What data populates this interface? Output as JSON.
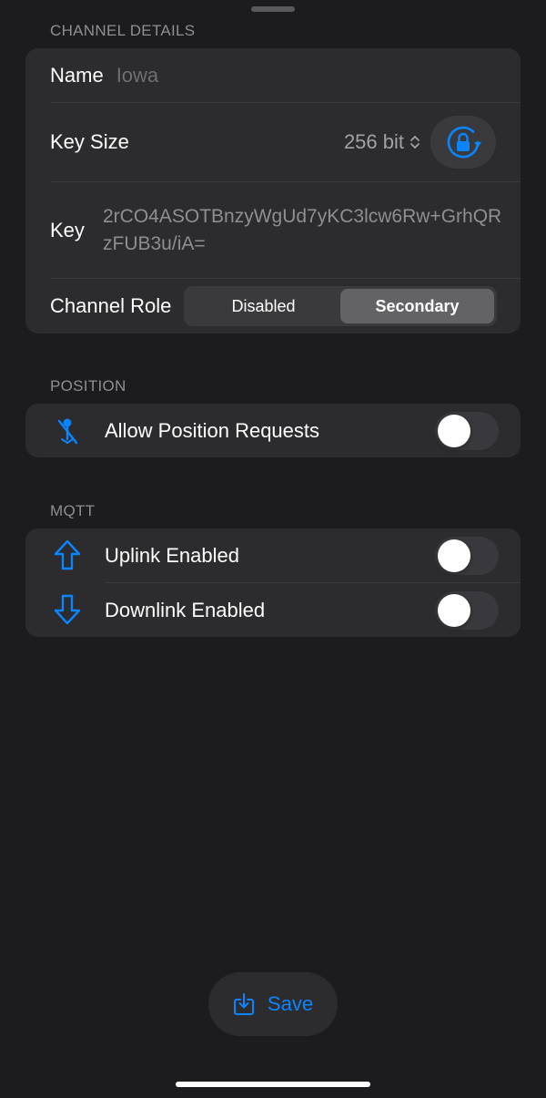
{
  "colors": {
    "background": "#1c1c1e",
    "card": "#2c2c2e",
    "accent": "#0a84ff",
    "secondary_text": "#8e8e93"
  },
  "channel_details": {
    "header": "CHANNEL DETAILS",
    "name_label": "Name",
    "name_value": "Iowa",
    "key_size_label": "Key Size",
    "key_size_value": "256 bit",
    "key_label": "Key",
    "key_value": "2rCO4ASOTBnzyWgUd7yKC3lcw6Rw+GrhQRzFUB3u/iA=",
    "channel_role_label": "Channel Role",
    "channel_role_options": [
      "Disabled",
      "Secondary"
    ],
    "channel_role_selected": "Secondary",
    "icons": {
      "key_size_picker": "chevron-up-down-icon",
      "regenerate_key": "lock-rotation-icon"
    }
  },
  "position": {
    "header": "POSITION",
    "allow_requests_label": "Allow Position Requests",
    "allow_requests_enabled": false,
    "icon": "location-slash-icon"
  },
  "mqtt": {
    "header": "MQTT",
    "uplink_label": "Uplink Enabled",
    "uplink_enabled": false,
    "uplink_icon": "arrow-up-icon",
    "downlink_label": "Downlink Enabled",
    "downlink_enabled": false,
    "downlink_icon": "arrow-down-icon"
  },
  "save": {
    "label": "Save",
    "icon": "download-tray-icon"
  }
}
